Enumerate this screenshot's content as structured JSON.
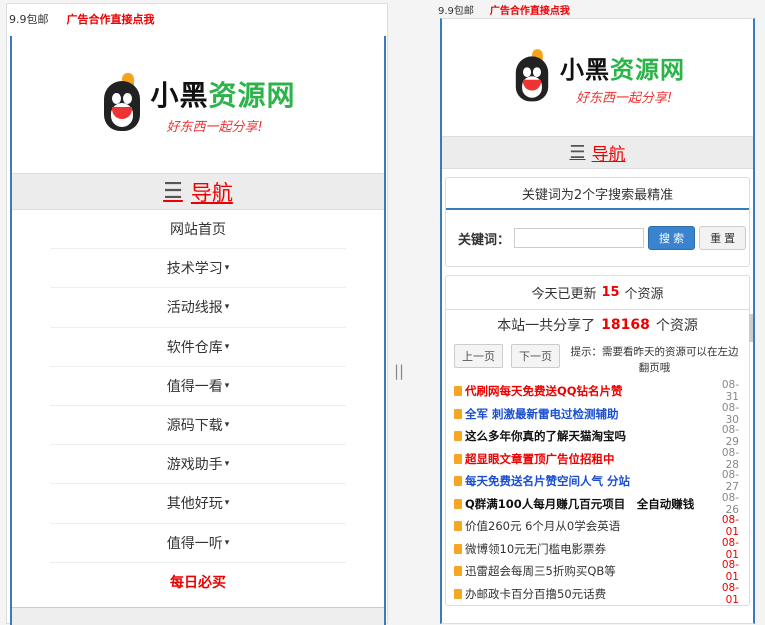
{
  "left": {
    "topbar": {
      "text": "9.9包邮",
      "ad": "广告合作直接点我"
    },
    "logo": {
      "name_black": "小黑",
      "name_green": "资源网",
      "slogan": "好东西一起分享!"
    },
    "nav": {
      "icon": "hamburger-icon",
      "label": "导航"
    },
    "menu": [
      {
        "label": "网站首页",
        "caret": false
      },
      {
        "label": "技术学习",
        "caret": true
      },
      {
        "label": "活动线报",
        "caret": true
      },
      {
        "label": "软件仓库",
        "caret": true
      },
      {
        "label": "值得一看",
        "caret": true
      },
      {
        "label": "源码下载",
        "caret": true
      },
      {
        "label": "游戏助手",
        "caret": true
      },
      {
        "label": "其他好玩",
        "caret": true
      },
      {
        "label": "值得一听",
        "caret": true
      },
      {
        "label": "每日必买",
        "caret": false
      }
    ]
  },
  "divider": "||",
  "right": {
    "topbar": {
      "text": "9.9包邮",
      "ad": "广告合作直接点我"
    },
    "logo": {
      "name_black": "小黑",
      "name_green": "资源网",
      "slogan": "好东西一起分享!"
    },
    "nav": {
      "label": "导航"
    },
    "search": {
      "heading": "关键词为2个字搜索最精准",
      "label": "关键词：",
      "input_value": "",
      "search_button": "搜 索",
      "reset_button": "重 置"
    },
    "updates": {
      "heading_pre": "今天已更新",
      "today_count": "15",
      "heading_post": "个资源",
      "total_pre": "本站一共分享了",
      "total_count": "18168",
      "total_post": "个资源",
      "prev": "上一页",
      "next": "下一页",
      "tip": "提示：需要看昨天的资源可以在左边翻页哦",
      "items": [
        {
          "title": "代刷网每天免费送QQ钻名片赞",
          "date": "08-31",
          "style": "red",
          "date_style": "gray"
        },
        {
          "title": "全军 刺激最新雷电过检测辅助",
          "date": "08-30",
          "style": "blue",
          "date_style": "gray"
        },
        {
          "title": "这么多年你真的了解天猫淘宝吗",
          "date": "08-29",
          "style": "black",
          "date_style": "gray"
        },
        {
          "title": "超显眼文章置顶广告位招租中",
          "date": "08-28",
          "style": "red",
          "date_style": "gray"
        },
        {
          "title": "每天免费送名片赞空间人气 分站",
          "date": "08-27",
          "style": "blue",
          "date_style": "gray"
        },
        {
          "title": "Q群满100人每月赚几百元项目　全自动赚钱",
          "date": "08-26",
          "style": "black",
          "date_style": "gray"
        },
        {
          "title": "价值260元 6个月从0学会英语",
          "date": "08-01",
          "style": "plain",
          "date_style": "red"
        },
        {
          "title": "微博领10元无门槛电影票券",
          "date": "08-01",
          "style": "plain",
          "date_style": "red"
        },
        {
          "title": "迅雷超会每周三5折购买QB等",
          "date": "08-01",
          "style": "plain",
          "date_style": "red"
        },
        {
          "title": "办邮政卡百分百撸50元话费",
          "date": "08-01",
          "style": "plain",
          "date_style": "red"
        }
      ]
    }
  }
}
